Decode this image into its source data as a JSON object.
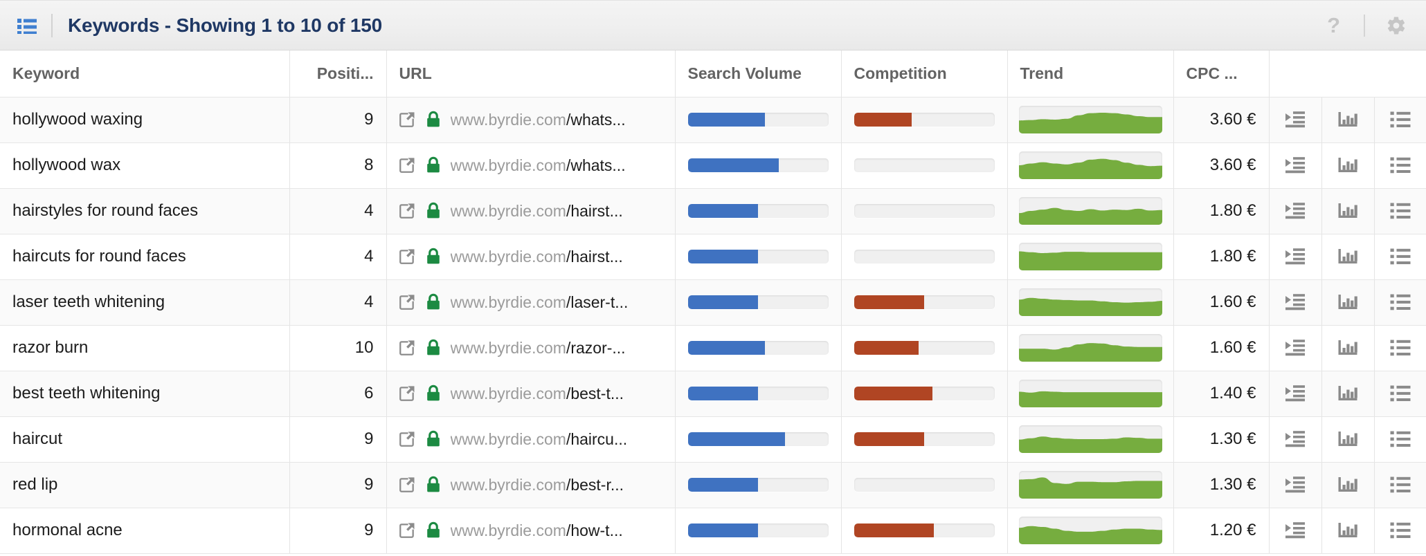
{
  "toolbar": {
    "menu_icon": "list-icon",
    "title": "Keywords - Showing 1 to 10 of 150",
    "help_label": "?",
    "help_icon": "question-mark-icon",
    "settings_icon": "gear-icon"
  },
  "colors": {
    "title": "#1f3864",
    "accent_blue": "#3f72c1",
    "accent_red": "#b04523",
    "accent_green": "#76ad3f",
    "lock_green": "#1c8a42",
    "header_text": "#636363",
    "row_alt": "#fafafa"
  },
  "table": {
    "columns": [
      {
        "key": "keyword",
        "label": "Keyword",
        "align": "left"
      },
      {
        "key": "position",
        "label": "Positi...",
        "align": "right"
      },
      {
        "key": "url",
        "label": "URL",
        "align": "left"
      },
      {
        "key": "search_volume",
        "label": "Search Volume",
        "align": "left"
      },
      {
        "key": "competition",
        "label": "Competition",
        "align": "left"
      },
      {
        "key": "trend",
        "label": "Trend",
        "align": "left"
      },
      {
        "key": "cpc",
        "label": "CPC ...",
        "align": "right"
      },
      {
        "key": "actions",
        "label": "",
        "align": "center"
      }
    ],
    "row_actions": [
      {
        "name": "add-to-list-icon",
        "title": ""
      },
      {
        "name": "bar-chart-icon",
        "title": ""
      },
      {
        "name": "details-list-icon",
        "title": ""
      }
    ],
    "rows": [
      {
        "keyword": "hollywood waxing",
        "position": "9",
        "url_host": "www.byrdie.com",
        "url_path": "/whats...",
        "external_link_icon": "external-link-icon",
        "secure_icon": "lock-icon",
        "search_volume_pct": 55,
        "competition_pct": 41,
        "trend": [
          30,
          31,
          33,
          32,
          34,
          42,
          47,
          48,
          47,
          44,
          40,
          38,
          38
        ],
        "cpc": "3.60 €"
      },
      {
        "keyword": "hollywood wax",
        "position": "8",
        "url_host": "www.byrdie.com",
        "url_path": "/whats...",
        "external_link_icon": "external-link-icon",
        "secure_icon": "lock-icon",
        "search_volume_pct": 65,
        "competition_pct": 0,
        "trend": [
          32,
          36,
          39,
          36,
          34,
          38,
          45,
          47,
          44,
          38,
          33,
          30,
          31
        ],
        "cpc": "3.60 €"
      },
      {
        "keyword": "hairstyles for round faces",
        "position": "4",
        "url_host": "www.byrdie.com",
        "url_path": "/hairst...",
        "external_link_icon": "external-link-icon",
        "secure_icon": "lock-icon",
        "search_volume_pct": 50,
        "competition_pct": 0,
        "trend": [
          27,
          32,
          35,
          39,
          34,
          32,
          36,
          33,
          35,
          34,
          37,
          33,
          34
        ],
        "cpc": "1.80 €"
      },
      {
        "keyword": "haircuts for round faces",
        "position": "4",
        "url_host": "www.byrdie.com",
        "url_path": "/hairst...",
        "external_link_icon": "external-link-icon",
        "secure_icon": "lock-icon",
        "search_volume_pct": 50,
        "competition_pct": 0,
        "trend": [
          44,
          42,
          40,
          41,
          43,
          43,
          42,
          42,
          42,
          42,
          42,
          42,
          42
        ],
        "cpc": "1.80 €"
      },
      {
        "keyword": "laser teeth whitening",
        "position": "4",
        "url_host": "www.byrdie.com",
        "url_path": "/laser-t...",
        "external_link_icon": "external-link-icon",
        "secure_icon": "lock-icon",
        "search_volume_pct": 50,
        "competition_pct": 50,
        "trend": [
          38,
          42,
          40,
          38,
          37,
          36,
          36,
          34,
          32,
          31,
          32,
          33,
          35
        ],
        "cpc": "1.60 €"
      },
      {
        "keyword": "razor burn",
        "position": "10",
        "url_host": "www.byrdie.com",
        "url_path": "/razor-...",
        "external_link_icon": "external-link-icon",
        "secure_icon": "lock-icon",
        "search_volume_pct": 55,
        "competition_pct": 46,
        "trend": [
          30,
          30,
          30,
          28,
          33,
          40,
          43,
          42,
          38,
          35,
          34,
          34,
          34
        ],
        "cpc": "1.60 €"
      },
      {
        "keyword": "best teeth whitening",
        "position": "6",
        "url_host": "www.byrdie.com",
        "url_path": "/best-t...",
        "external_link_icon": "external-link-icon",
        "secure_icon": "lock-icon",
        "search_volume_pct": 50,
        "competition_pct": 56,
        "trend": [
          36,
          34,
          37,
          36,
          35,
          35,
          35,
          35,
          35,
          35,
          35,
          35,
          35
        ],
        "cpc": "1.40 €"
      },
      {
        "keyword": "haircut",
        "position": "9",
        "url_host": "www.byrdie.com",
        "url_path": "/haircu...",
        "external_link_icon": "external-link-icon",
        "secure_icon": "lock-icon",
        "search_volume_pct": 69,
        "competition_pct": 50,
        "trend": [
          31,
          34,
          38,
          35,
          33,
          32,
          32,
          32,
          33,
          36,
          35,
          33,
          33
        ],
        "cpc": "1.30 €"
      },
      {
        "keyword": "red lip",
        "position": "9",
        "url_host": "www.byrdie.com",
        "url_path": "/best-r...",
        "external_link_icon": "external-link-icon",
        "secure_icon": "lock-icon",
        "search_volume_pct": 50,
        "competition_pct": 0,
        "trend": [
          44,
          45,
          49,
          36,
          34,
          39,
          39,
          38,
          38,
          40,
          41,
          41,
          41
        ],
        "cpc": "1.30 €"
      },
      {
        "keyword": "hormonal acne",
        "position": "9",
        "url_host": "www.byrdie.com",
        "url_path": "/how-t...",
        "external_link_icon": "external-link-icon",
        "secure_icon": "lock-icon",
        "search_volume_pct": 50,
        "competition_pct": 57,
        "trend": [
          38,
          42,
          40,
          36,
          31,
          29,
          29,
          31,
          34,
          36,
          36,
          34,
          33
        ],
        "cpc": "1.20 €"
      }
    ]
  }
}
